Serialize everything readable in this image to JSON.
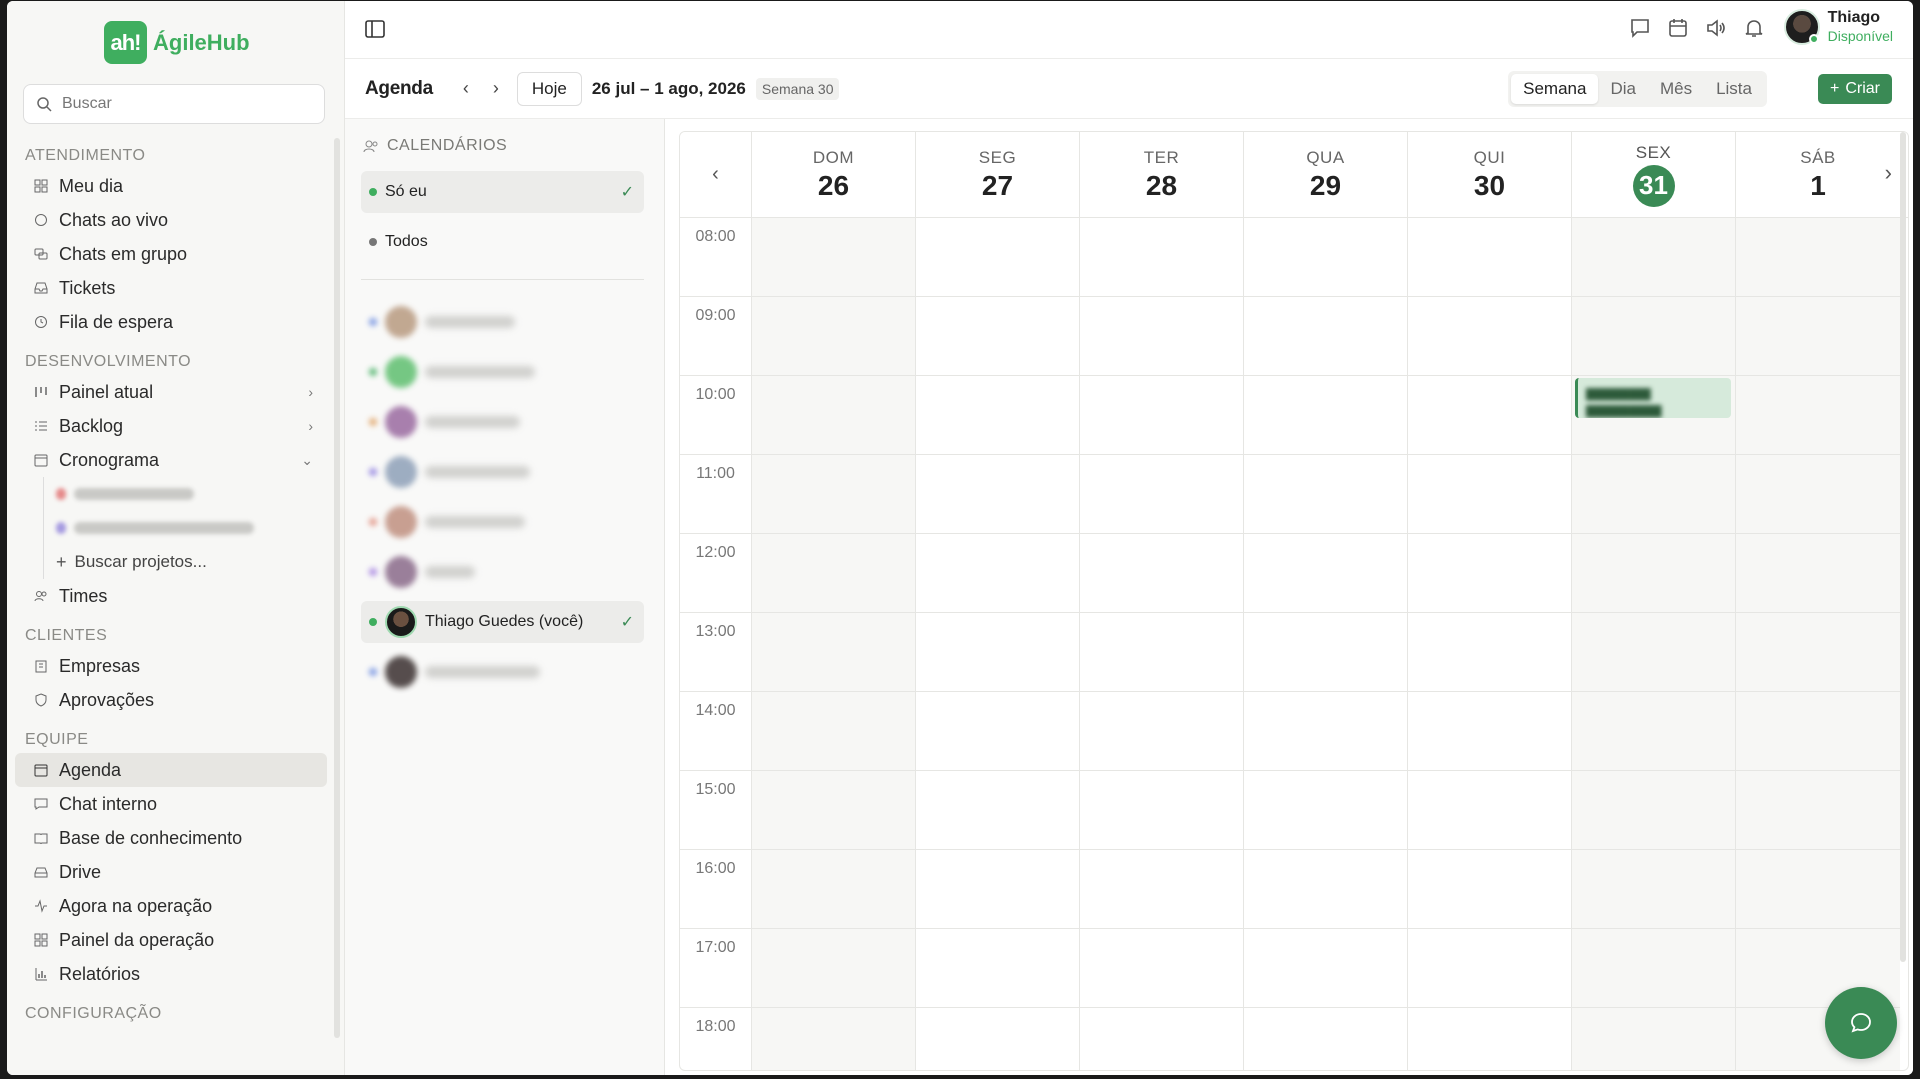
{
  "app": {
    "name": "ÁgileHub",
    "logo_mark": "ah!"
  },
  "search": {
    "placeholder": "Buscar"
  },
  "sidebar": {
    "sections": [
      {
        "title": "ATENDIMENTO",
        "items": [
          {
            "label": "Meu dia",
            "icon": "grid-icon"
          },
          {
            "label": "Chats ao vivo",
            "icon": "chat-bubble-icon"
          },
          {
            "label": "Chats em grupo",
            "icon": "group-chat-icon"
          },
          {
            "label": "Tickets",
            "icon": "inbox-icon"
          },
          {
            "label": "Fila de espera",
            "icon": "clock-icon"
          }
        ]
      },
      {
        "title": "DESENVOLVIMENTO",
        "items": [
          {
            "label": "Painel atual",
            "icon": "kanban-icon"
          },
          {
            "label": "Backlog",
            "icon": "list-icon"
          },
          {
            "label": "Cronograma",
            "icon": "calendar-icon"
          }
        ]
      },
      {
        "title": "CLIENTES",
        "items": [
          {
            "label": "Empresas",
            "icon": "building-icon"
          },
          {
            "label": "Aprovações",
            "icon": "shield-icon"
          }
        ]
      },
      {
        "title": "EQUIPE",
        "items": [
          {
            "label": "Agenda",
            "icon": "calendar-icon"
          },
          {
            "label": "Chat interno",
            "icon": "chat-bubble-icon"
          },
          {
            "label": "Base de conhecimento",
            "icon": "book-icon"
          },
          {
            "label": "Drive",
            "icon": "drive-icon"
          },
          {
            "label": "Agora na operação",
            "icon": "activity-icon"
          },
          {
            "label": "Painel da operação",
            "icon": "grid-icon"
          },
          {
            "label": "Relatórios",
            "icon": "bar-chart-icon"
          }
        ]
      },
      {
        "title": "CONFIGURAÇÃO",
        "items": []
      }
    ],
    "teams_label": "Times",
    "search_projects_label": "Buscar projetos..."
  },
  "topbar": {
    "user_name": "Thiago",
    "user_status": "Disponível"
  },
  "agenda": {
    "title": "Agenda",
    "today_button": "Hoje",
    "range": "26 jul – 1 ago, 2026",
    "week_badge": "Semana 30",
    "views": [
      "Semana",
      "Dia",
      "Mês",
      "Lista"
    ],
    "selected_view": "Semana",
    "create_button": "Criar"
  },
  "calendars": {
    "header": "CALENDÁRIOS",
    "only_me": "Só eu",
    "all": "Todos",
    "me_label": "Thiago Guedes (você)"
  },
  "week": {
    "days": [
      {
        "name": "DOM",
        "num": "26"
      },
      {
        "name": "SEG",
        "num": "27"
      },
      {
        "name": "TER",
        "num": "28"
      },
      {
        "name": "QUA",
        "num": "29"
      },
      {
        "name": "QUI",
        "num": "30"
      },
      {
        "name": "SEX",
        "num": "31"
      },
      {
        "name": "SÁB",
        "num": "1"
      }
    ],
    "hours": [
      "08:00",
      "09:00",
      "10:00",
      "11:00",
      "12:00",
      "13:00",
      "14:00",
      "15:00",
      "16:00",
      "17:00",
      "18:00"
    ]
  },
  "colors": {
    "brand": "#3fae5f",
    "accent": "#3a8a55"
  }
}
